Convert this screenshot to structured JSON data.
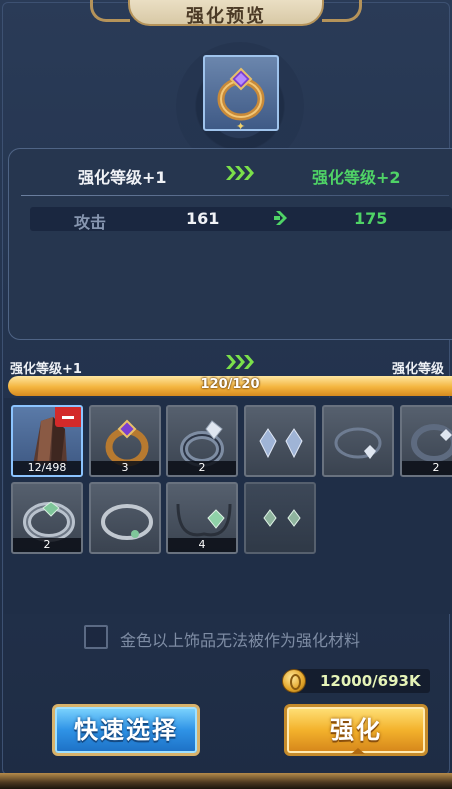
{
  "header": {
    "title": "强化预览"
  },
  "preview_item": {
    "icon": "gold-ring-purple-gem-icon"
  },
  "stats": {
    "current_level": "强化等级+1",
    "next_level": "强化等级+2",
    "attack_label": "攻击",
    "attack_current": "161",
    "attack_next": "175"
  },
  "progress": {
    "left_label": "强化等级+1",
    "right_label": "强化等级",
    "text": "120/120",
    "fraction": 1.0
  },
  "materials": [
    {
      "icon": "dark-crystal-icon",
      "count": "12/498",
      "selected": true,
      "removable": true
    },
    {
      "icon": "gold-ring-icon",
      "count": "3"
    },
    {
      "icon": "silver-ring-gem-icon",
      "count": "2"
    },
    {
      "icon": "crystal-earrings-icon",
      "count": ""
    },
    {
      "icon": "silver-bracelet-icon",
      "count": ""
    },
    {
      "icon": "silver-ring-icon",
      "count": "2"
    },
    {
      "icon": "silver-ring-green-gem-icon",
      "count": "2"
    },
    {
      "icon": "silver-ring-thin-icon",
      "count": ""
    },
    {
      "icon": "dark-necklace-icon",
      "count": "4"
    },
    {
      "icon": "green-earrings-icon",
      "count": ""
    }
  ],
  "filter": {
    "label": "金色以上饰品无法被作为强化材料",
    "checked": false
  },
  "cost": {
    "text": "12000/693K",
    "icon": "gold-coin-icon"
  },
  "buttons": {
    "quick_select": "快速选择",
    "enhance": "强化"
  },
  "colors": {
    "green": "#4fd366",
    "gold": "#f3b22c",
    "blue": "#2f93e6"
  }
}
